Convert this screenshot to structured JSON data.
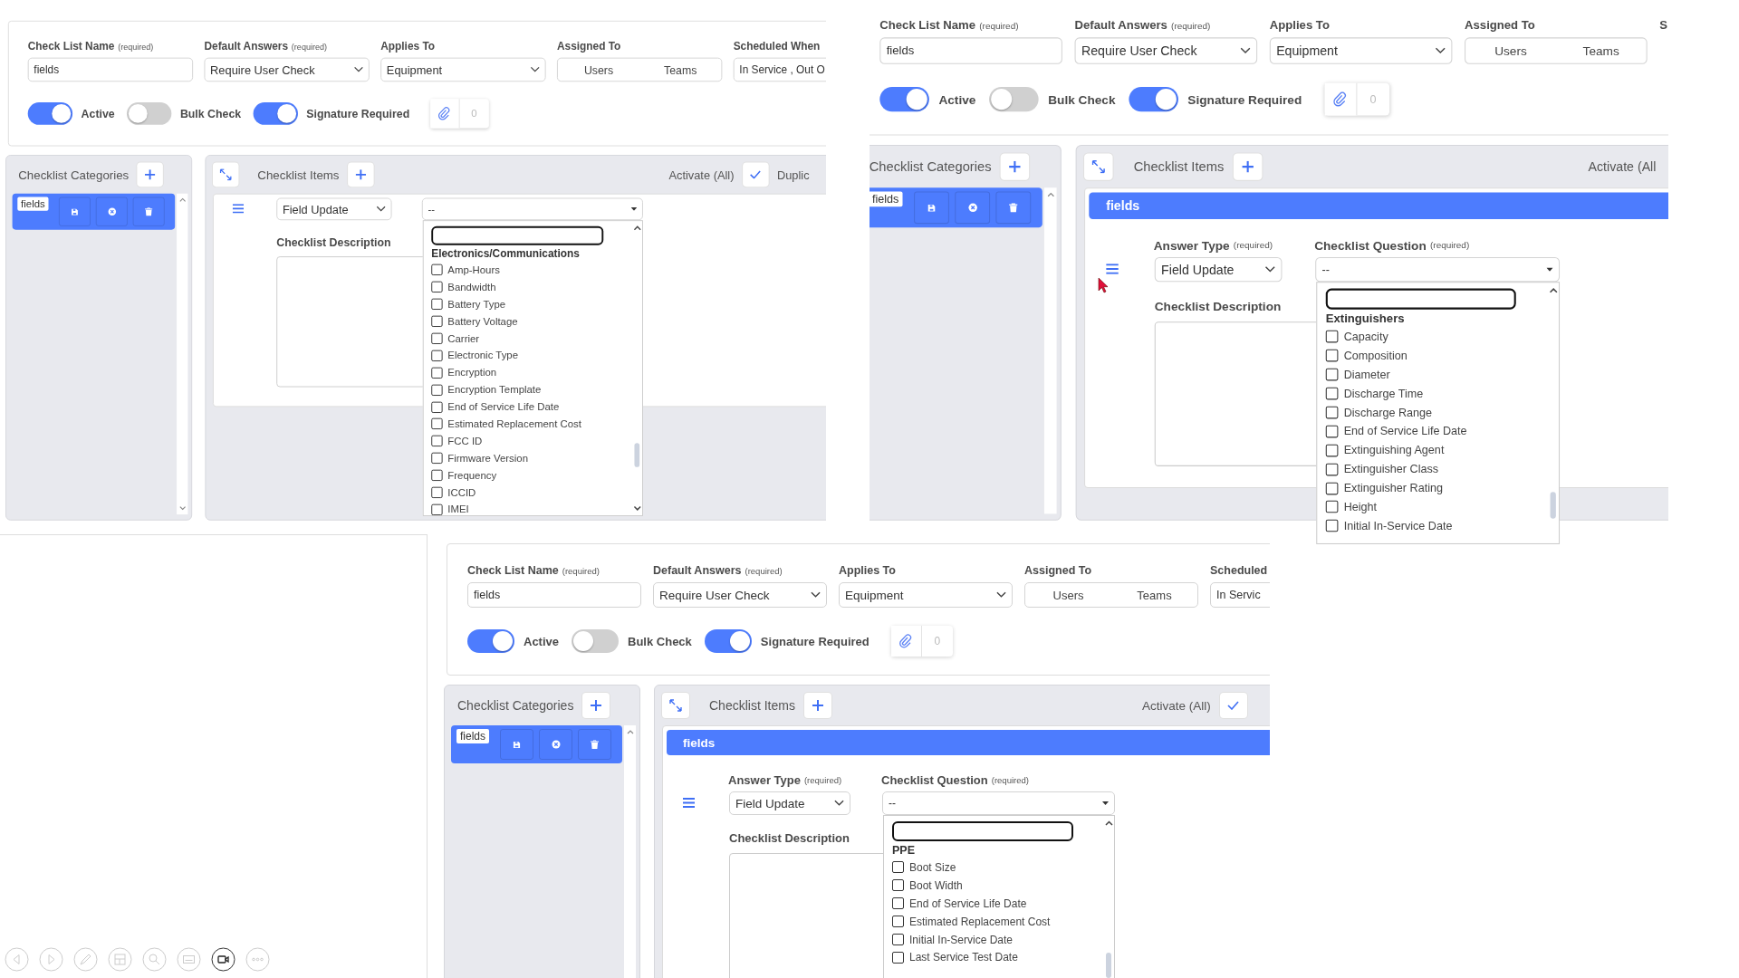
{
  "shots": [
    {
      "form": {
        "fields": [
          {
            "kind": "text",
            "label": "Check List Name",
            "hint": "(required)",
            "value": "fields"
          },
          {
            "kind": "select",
            "label": "Default Answers",
            "hint": "(required)",
            "value": "Require User Check"
          },
          {
            "kind": "select",
            "label": "Applies To",
            "value": "Equipment"
          },
          {
            "kind": "segmented",
            "label": "Assigned To",
            "options": [
              "Users",
              "Teams"
            ]
          },
          {
            "kind": "text",
            "label": "Scheduled When",
            "value": "In Service , Out O"
          }
        ],
        "toggles": [
          {
            "label": "Active",
            "on": true
          },
          {
            "label": "Bulk Check",
            "on": false
          },
          {
            "label": "Signature Required",
            "on": true
          }
        ],
        "attachments": "0"
      },
      "categories": {
        "title": "Checklist Categories",
        "items": [
          {
            "label": "fields",
            "selected": true
          }
        ]
      },
      "items": {
        "title": "Checklist Items",
        "actions": [
          {
            "kind": "text",
            "label": "Activate (All)"
          },
          {
            "kind": "check"
          },
          {
            "kind": "text",
            "label": "Duplic"
          }
        ],
        "answer_type": {
          "value": "Field Update"
        },
        "question": {
          "value": "--"
        },
        "description_label": "Checklist Description",
        "dropdown": {
          "group": "Electronics/Communications",
          "options": [
            {
              "label": "Amp-Hours",
              "checked": false
            },
            {
              "label": "Bandwidth",
              "checked": false
            },
            {
              "label": "Battery Type",
              "checked": false
            },
            {
              "label": "Battery Voltage",
              "checked": false
            },
            {
              "label": "Carrier",
              "checked": false
            },
            {
              "label": "Electronic Type",
              "checked": false
            },
            {
              "label": "Encryption",
              "checked": false
            },
            {
              "label": "Encryption Template",
              "checked": false
            },
            {
              "label": "End of Service Life Date",
              "checked": false
            },
            {
              "label": "Estimated Replacement Cost",
              "checked": false
            },
            {
              "label": "FCC ID",
              "checked": false
            },
            {
              "label": "Firmware Version",
              "checked": false
            },
            {
              "label": "Frequency",
              "checked": false
            },
            {
              "label": "ICCID",
              "checked": false
            },
            {
              "label": "IMEI",
              "checked": false
            }
          ]
        }
      }
    },
    {
      "form": {
        "fields": [
          {
            "kind": "text",
            "label": "Check List Name",
            "hint": "(required)",
            "value": "fields"
          },
          {
            "kind": "select",
            "label": "Default Answers",
            "hint": "(required)",
            "value": "Require User Check"
          },
          {
            "kind": "select",
            "label": "Applies To",
            "value": "Equipment"
          },
          {
            "kind": "segmented",
            "label": "Assigned To",
            "options": [
              "Users",
              "Teams"
            ]
          },
          {
            "kind": "text",
            "label": "S"
          }
        ],
        "toggles": [
          {
            "label": "Active",
            "on": true
          },
          {
            "label": "Bulk Check",
            "on": false
          },
          {
            "label": "Signature Required",
            "on": true
          }
        ],
        "attachments": "0"
      },
      "categories": {
        "title": "Checklist Categories",
        "items": [
          {
            "label": "fields",
            "selected": true
          }
        ]
      },
      "items": {
        "title": "Checklist Items",
        "actions": [
          {
            "kind": "text",
            "label": "Activate (All"
          }
        ],
        "group_title": "fields",
        "answer_type": {
          "label": "Answer Type",
          "hint": "(required)",
          "value": "Field Update"
        },
        "question": {
          "label": "Checklist Question",
          "hint": "(required)",
          "value": "--"
        },
        "description_label": "Checklist Description",
        "dropdown": {
          "group": "Extinguishers",
          "options": [
            {
              "label": "Capacity",
              "checked": false
            },
            {
              "label": "Composition",
              "checked": false
            },
            {
              "label": "Diameter",
              "checked": false
            },
            {
              "label": "Discharge Time",
              "checked": false
            },
            {
              "label": "Discharge Range",
              "checked": false
            },
            {
              "label": "End of Service Life Date",
              "checked": false
            },
            {
              "label": "Extinguishing Agent",
              "checked": false
            },
            {
              "label": "Extinguisher Class",
              "checked": false
            },
            {
              "label": "Extinguisher Rating",
              "checked": false
            },
            {
              "label": "Height",
              "checked": false
            },
            {
              "label": "Initial In-Service Date",
              "checked": false
            }
          ]
        }
      }
    },
    {
      "form": {
        "fields": [
          {
            "kind": "text",
            "label": "Check List Name",
            "hint": "(required)",
            "value": "fields"
          },
          {
            "kind": "select",
            "label": "Default Answers",
            "hint": "(required)",
            "value": "Require User Check"
          },
          {
            "kind": "select",
            "label": "Applies To",
            "value": "Equipment"
          },
          {
            "kind": "segmented",
            "label": "Assigned To",
            "options": [
              "Users",
              "Teams"
            ]
          },
          {
            "kind": "text",
            "label": "Scheduled",
            "value": "In Servic"
          }
        ],
        "toggles": [
          {
            "label": "Active",
            "on": true
          },
          {
            "label": "Bulk Check",
            "on": false
          },
          {
            "label": "Signature Required",
            "on": true
          }
        ],
        "attachments": "0"
      },
      "categories": {
        "title": "Checklist Categories",
        "items": [
          {
            "label": "fields",
            "selected": true
          }
        ]
      },
      "items": {
        "title": "Checklist Items",
        "actions": [
          {
            "kind": "text",
            "label": "Activate (All)"
          },
          {
            "kind": "check"
          }
        ],
        "group_title": "fields",
        "answer_type": {
          "label": "Answer Type",
          "hint": "(required)",
          "value": "Field Update"
        },
        "question": {
          "label": "Checklist Question",
          "hint": "(required)",
          "value": "--"
        },
        "description_label": "Checklist Description",
        "dropdown": {
          "group": "PPE",
          "options": [
            {
              "label": "Boot Size",
              "checked": false
            },
            {
              "label": "Boot Width",
              "checked": false
            },
            {
              "label": "End of Service Life Date",
              "checked": false
            },
            {
              "label": "Estimated Replacement Cost",
              "checked": false
            },
            {
              "label": "Initial In-Service Date",
              "checked": false
            },
            {
              "label": "Last Service Test Date",
              "checked": false
            }
          ]
        }
      }
    }
  ]
}
